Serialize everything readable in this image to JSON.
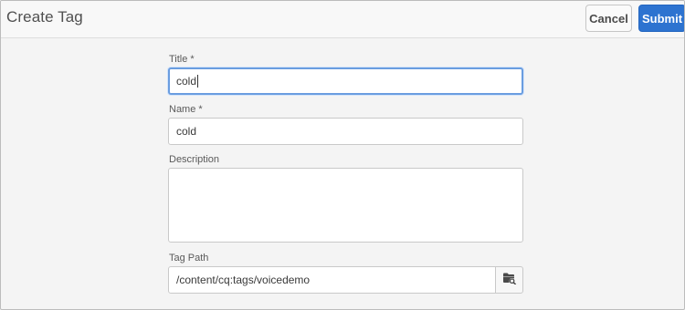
{
  "dialog": {
    "title": "Create Tag"
  },
  "actions": {
    "cancel_label": "Cancel",
    "submit_label": "Submit"
  },
  "form": {
    "title_label": "Title *",
    "title_value": "cold",
    "name_label": "Name *",
    "name_value": "cold",
    "description_label": "Description",
    "description_value": "",
    "tag_path_label": "Tag Path",
    "tag_path_value": "/content/cq:tags/voicedemo",
    "browse_icon": "folder-search-icon"
  },
  "colors": {
    "accent": "#2d73d0",
    "focus_ring": "#6a9de0"
  }
}
